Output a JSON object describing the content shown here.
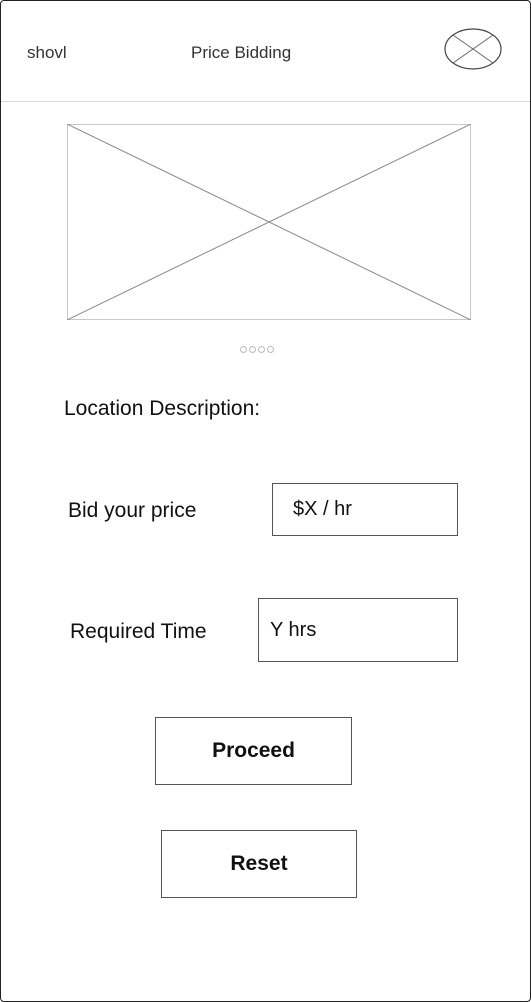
{
  "header": {
    "brand": "shovl",
    "title": "Price Bidding",
    "avatar_icon": "user-avatar-placeholder-icon"
  },
  "hero": {
    "image_icon": "image-placeholder-icon",
    "pager_dot_count": 4
  },
  "form": {
    "location_label": "Location Description:",
    "bid_label": "Bid your price",
    "bid_value": "$X / hr",
    "time_label": "Required Time",
    "time_value": "Y hrs"
  },
  "actions": {
    "proceed_label": "Proceed",
    "reset_label": "Reset"
  },
  "colors": {
    "border": "#555555",
    "divider": "#d9d9d9",
    "placeholder_stroke": "#888888"
  }
}
